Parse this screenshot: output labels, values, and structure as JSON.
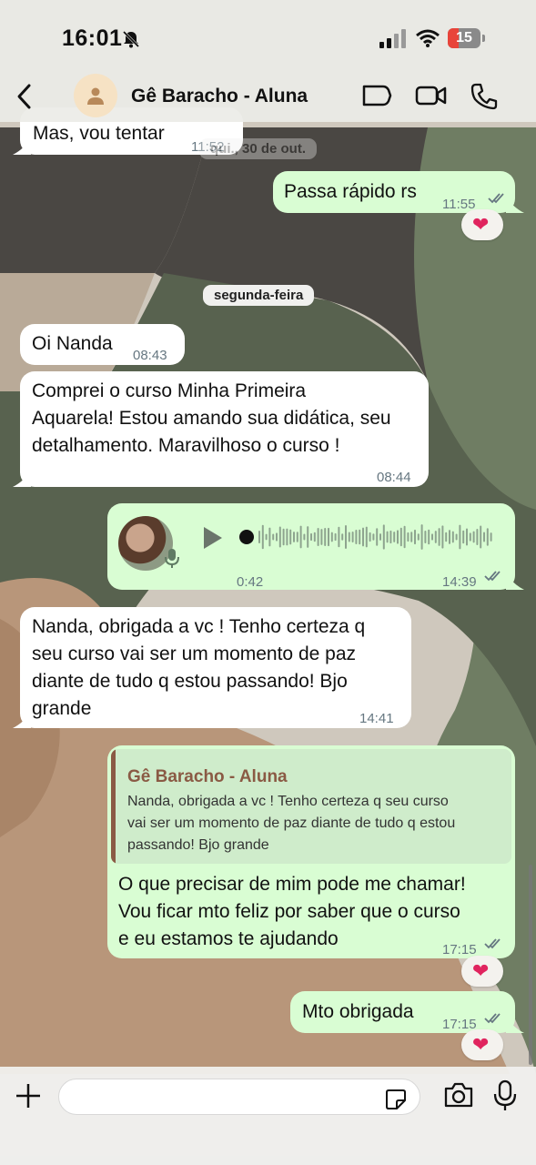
{
  "status": {
    "time": "16:01",
    "battery": "15"
  },
  "header": {
    "contact_name": "Gê Baracho - Aluna"
  },
  "messages": {
    "m1_text": "Mas, vou tentar",
    "m1_time": "11:52",
    "date_faded": "qui., 30 de out.",
    "m2_text": "Passa rápido rs",
    "m2_time": "11:55",
    "date_chip": "segunda-feira",
    "m3_text": "Oi Nanda",
    "m3_time": "08:43",
    "m4_line1": "Comprei o curso Minha Primeira",
    "m4_line2": "Aquarela! Estou amando sua didática, seu",
    "m4_line3": "detalhamento. Maravilhoso o curso !",
    "m4_time": "08:44",
    "voice_duration": "0:42",
    "voice_time": "14:39",
    "m5_line1": "Nanda, obrigada a vc ! Tenho certeza q",
    "m5_line2": "seu curso vai ser um momento de paz",
    "m5_line3": "diante de tudo q estou passando! Bjo",
    "m5_line4": "grande",
    "m5_time": "14:41",
    "quote_name": "Gê Baracho - Aluna",
    "quote_line1": "Nanda, obrigada a vc ! Tenho certeza q seu curso",
    "quote_line2": "vai ser um momento de paz diante de tudo q estou",
    "quote_line3": "passando! Bjo grande",
    "m6_line1": "O que precisar de mim pode me chamar!",
    "m6_line2": "Vou ficar mto feliz por saber que o curso",
    "m6_line3": "e eu estamos te ajudando",
    "m6_time": "17:15",
    "m7_text": "Mto obrigada",
    "m7_time": "17:15"
  },
  "colors": {
    "outgoing": "#d9fdd3",
    "incoming": "#ffffff",
    "accent_reply": "#8a5a44",
    "read_ticks": "#667781"
  },
  "icons": [
    "back-chevron-icon",
    "person-icon",
    "label-icon",
    "video-call-icon",
    "phone-icon",
    "heart-icon",
    "play-icon",
    "mic-icon",
    "plus-icon",
    "sticker-icon",
    "camera-icon",
    "double-check-icon",
    "muted-bell-icon",
    "signal-icon",
    "wifi-icon"
  ]
}
